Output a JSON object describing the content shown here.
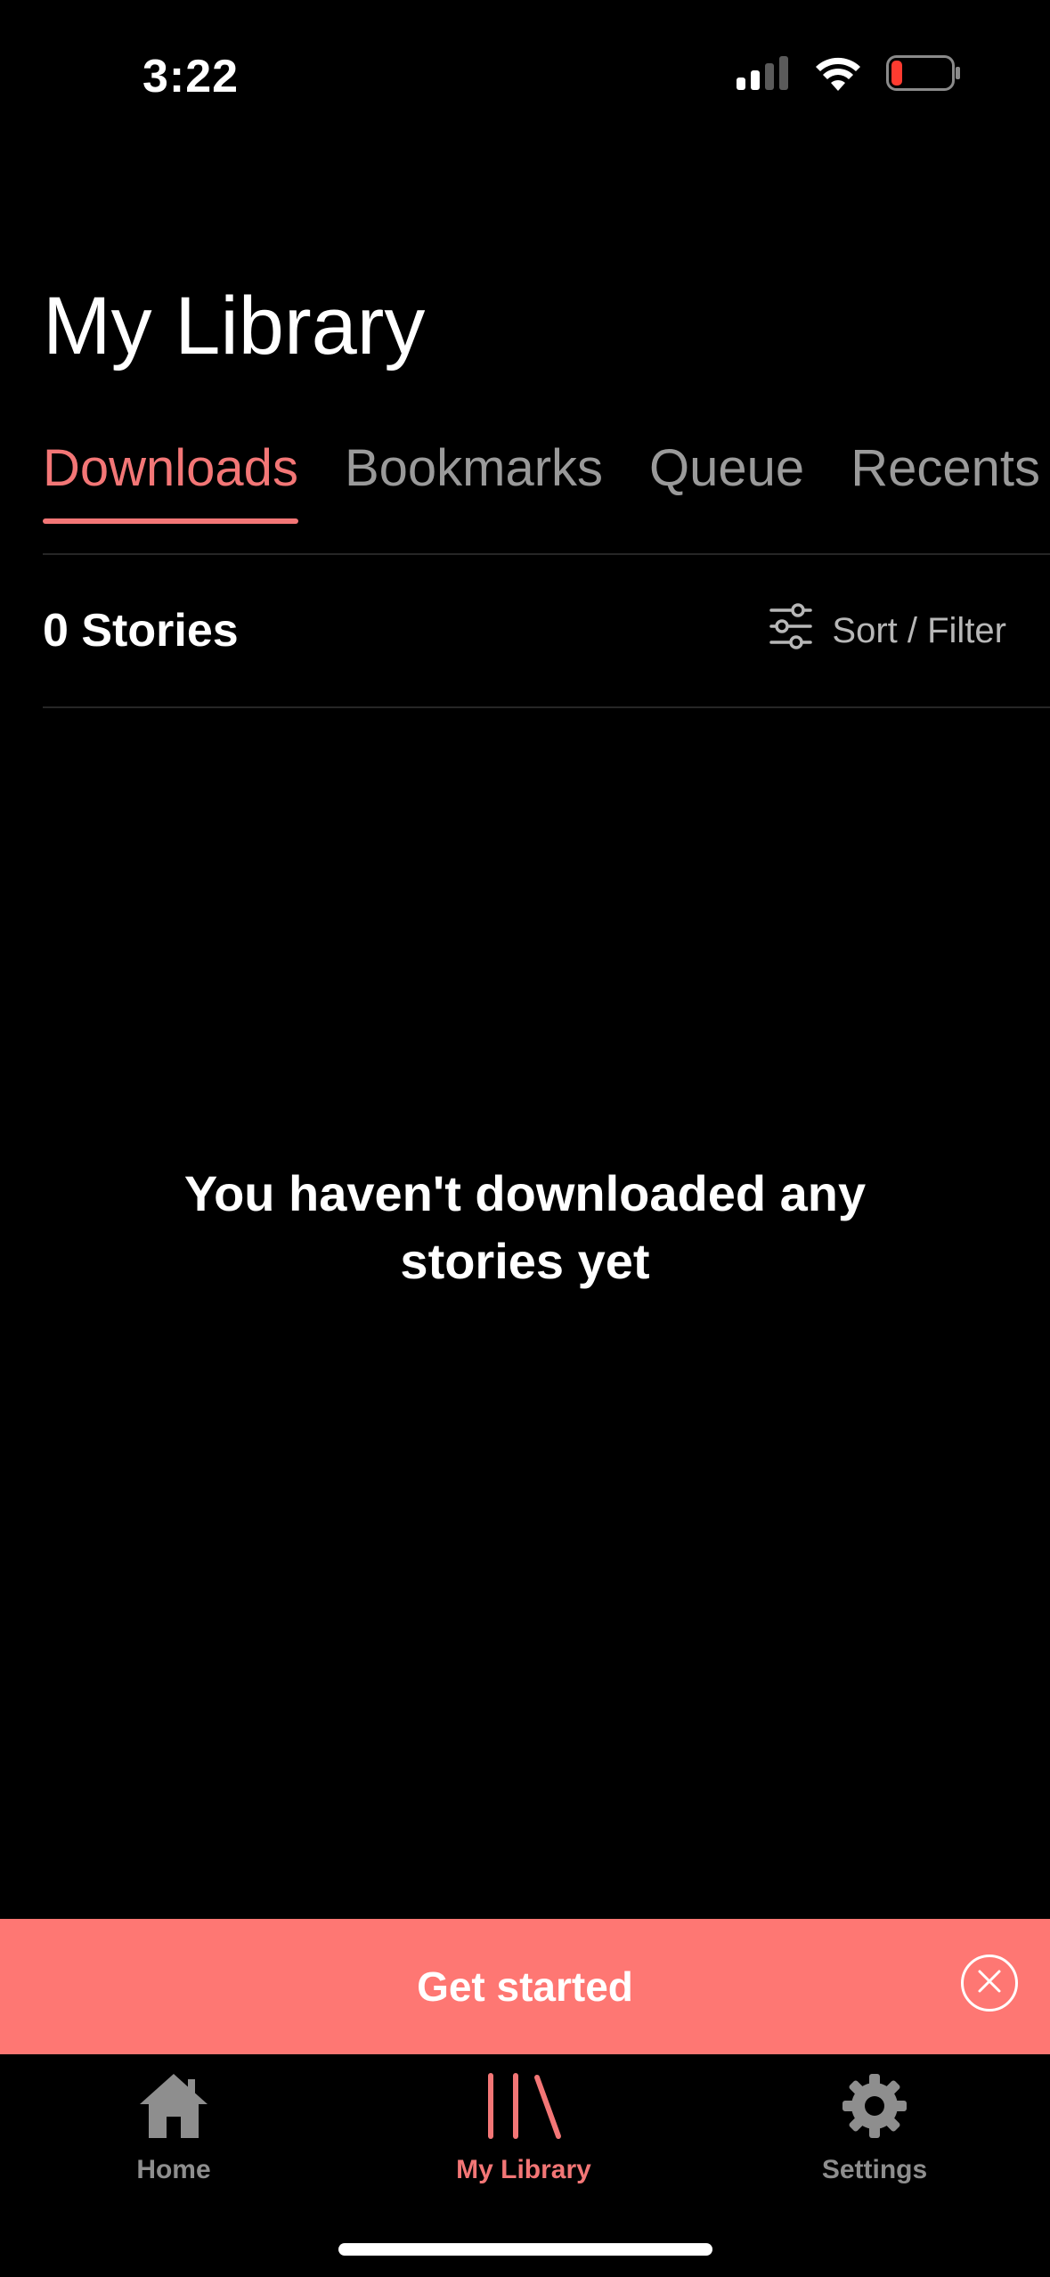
{
  "status_bar": {
    "time": "3:22"
  },
  "header": {
    "title": "My Library"
  },
  "tabs": [
    {
      "label": "Downloads",
      "active": true
    },
    {
      "label": "Bookmarks",
      "active": false
    },
    {
      "label": "Queue",
      "active": false
    },
    {
      "label": "Recents",
      "active": false
    }
  ],
  "list_header": {
    "count": "0 Stories",
    "sort_filter_label": "Sort / Filter"
  },
  "empty_state": {
    "message": "You haven't downloaded any stories yet"
  },
  "banner": {
    "label": "Get started"
  },
  "bottom_nav": {
    "items": [
      {
        "label": "Home",
        "icon": "home-icon",
        "active": false
      },
      {
        "label": "My Library",
        "icon": "library-icon",
        "active": true
      },
      {
        "label": "Settings",
        "icon": "gear-icon",
        "active": false
      }
    ]
  },
  "colors": {
    "accent": "#f37676",
    "banner": "#fe7773",
    "background": "#000000",
    "inactive": "#9a9a9a",
    "battery_low": "#ff3b30"
  }
}
